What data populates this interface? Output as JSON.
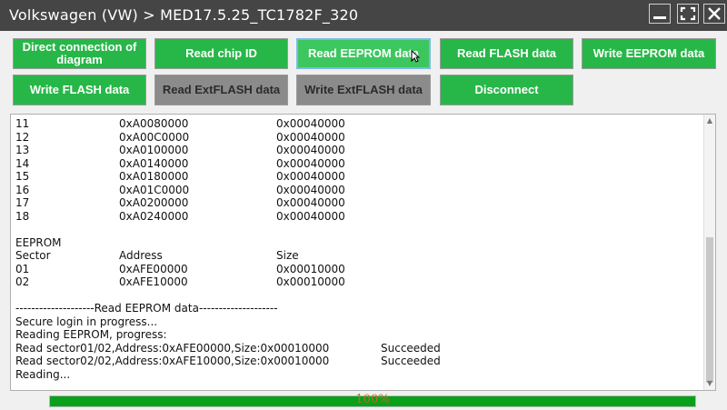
{
  "window": {
    "title": "Volkswagen (VW) > MED17.5.25_TC1782F_320"
  },
  "buttons": {
    "direct_connection": "Direct connection of diagram",
    "read_chip_id": "Read chip ID",
    "read_eeprom": "Read EEPROM data",
    "read_flash": "Read FLASH data",
    "write_eeprom": "Write EEPROM data",
    "write_flash": "Write FLASH data",
    "read_extflash": "Read ExtFLASH data",
    "write_extflash": "Write ExtFLASH data",
    "disconnect": "Disconnect"
  },
  "log": {
    "flash_rows": [
      {
        "sector": "11",
        "address": "0xA0080000",
        "size": "0x00040000"
      },
      {
        "sector": "12",
        "address": "0xA00C0000",
        "size": "0x00040000"
      },
      {
        "sector": "13",
        "address": "0xA0100000",
        "size": "0x00040000"
      },
      {
        "sector": "14",
        "address": "0xA0140000",
        "size": "0x00040000"
      },
      {
        "sector": "15",
        "address": "0xA0180000",
        "size": "0x00040000"
      },
      {
        "sector": "16",
        "address": "0xA01C0000",
        "size": "0x00040000"
      },
      {
        "sector": "17",
        "address": "0xA0200000",
        "size": "0x00040000"
      },
      {
        "sector": "18",
        "address": "0xA0240000",
        "size": "0x00040000"
      }
    ],
    "eeprom_heading": "EEPROM",
    "headers": {
      "sector": "Sector",
      "address": "Address",
      "size": "Size"
    },
    "eeprom_rows": [
      {
        "sector": "01",
        "address": "0xAFE00000",
        "size": "0x00010000"
      },
      {
        "sector": "02",
        "address": "0xAFE10000",
        "size": "0x00010000"
      }
    ],
    "separator": "--------------------Read EEPROM data--------------------",
    "msg_login": "Secure login in progress...",
    "msg_reading_progress": "Reading EEPROM, progress:",
    "read_results": [
      {
        "text": "Read sector01/02,Address:0xAFE00000,Size:0x00010000",
        "status": "Succeeded"
      },
      {
        "text": "Read sector02/02,Address:0xAFE10000,Size:0x00010000",
        "status": "Succeeded"
      }
    ],
    "msg_reading": "Reading..."
  },
  "progress": {
    "percent": 100,
    "label": "100%"
  },
  "colors": {
    "button_green": "#27b748",
    "button_gray": "#8b8b8b",
    "titlebar": "#454545",
    "progress_fill": "#09a01b",
    "progress_text": "#c46a1a"
  }
}
